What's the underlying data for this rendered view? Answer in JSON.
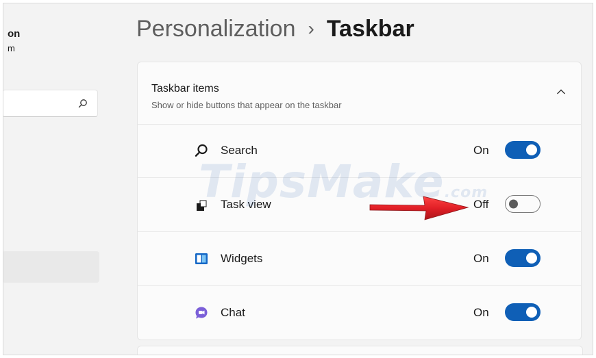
{
  "sidebar": {
    "profile_name_fragment": "on",
    "profile_sub_fragment": "m",
    "search_icon": "search-icon"
  },
  "header": {
    "breadcrumb_parent": "Personalization",
    "separator": "›",
    "current_page": "Taskbar"
  },
  "taskbar_items": {
    "title": "Taskbar items",
    "description": "Show or hide buttons that appear on the taskbar",
    "collapse_icon": "chevron-up-icon",
    "items": [
      {
        "label": "Search",
        "state_label": "On",
        "enabled": true,
        "icon": "search-icon"
      },
      {
        "label": "Task view",
        "state_label": "Off",
        "enabled": false,
        "icon": "task-view-icon"
      },
      {
        "label": "Widgets",
        "state_label": "On",
        "enabled": true,
        "icon": "widgets-icon"
      },
      {
        "label": "Chat",
        "state_label": "On",
        "enabled": true,
        "icon": "chat-icon"
      }
    ]
  },
  "watermark": {
    "text": "TipsMake",
    "suffix": ".com"
  },
  "colors": {
    "accent": "#0f5fb6",
    "arrow": "#e0141b",
    "background": "#f3f3f3"
  }
}
